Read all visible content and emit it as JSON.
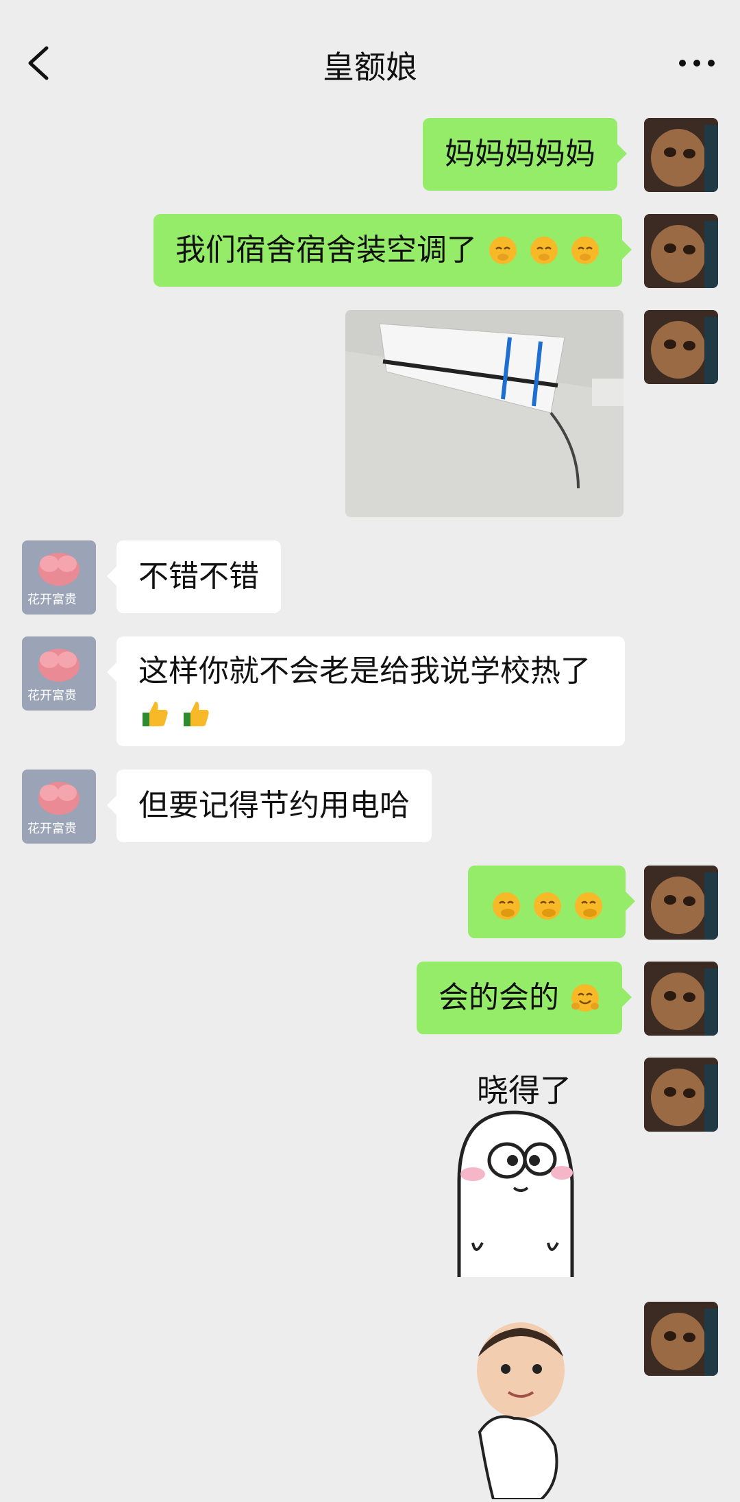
{
  "header": {
    "title": "皇额娘"
  },
  "avatar_in_caption": "花开富贵",
  "messages": [
    {
      "text": "妈妈妈妈妈",
      "emoji": []
    },
    {
      "text": "我们宿舍宿舍装空调了",
      "emoji": [
        "blush",
        "blush",
        "blush"
      ]
    },
    {
      "text": "不错不错"
    },
    {
      "line1": "这样你就不会老是给我说学校热了",
      "emoji": [
        "thumbs-up",
        "thumbs-up"
      ]
    },
    {
      "text": "但要记得节约用电哈"
    },
    {
      "emoji": [
        "hand-over-mouth",
        "hand-over-mouth",
        "hand-over-mouth"
      ]
    },
    {
      "text": "会的会的",
      "emoji": [
        "hugging"
      ]
    }
  ],
  "stickers": {
    "xiaode_caption": "晓得了"
  },
  "colors": {
    "background": "#ededed",
    "outgoing": "#95ec69",
    "incoming": "#ffffff"
  }
}
